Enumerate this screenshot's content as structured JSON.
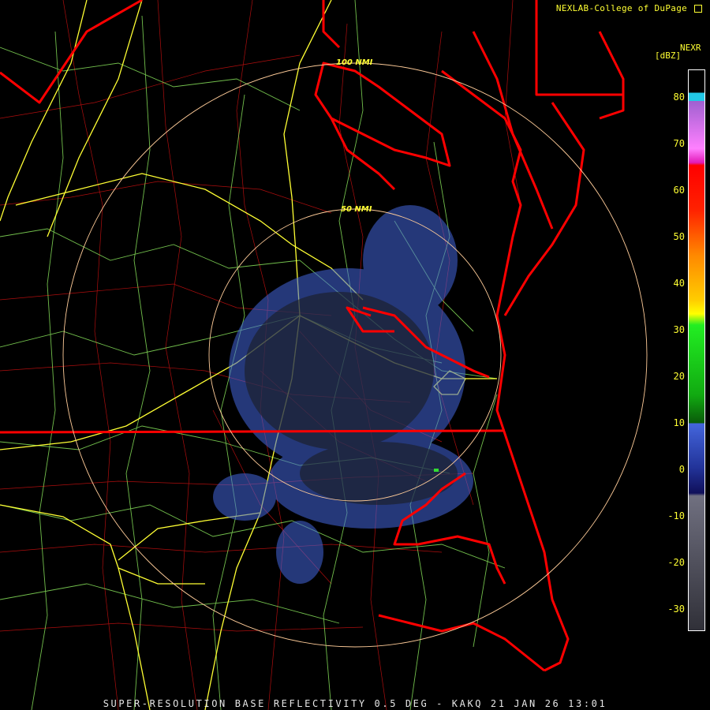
{
  "credit": "NEXLAB-College of DuPage",
  "footer": "SUPER-RESOLUTION BASE REFLECTIVITY 0.5 DEG - KAKQ 21 JAN 26 13:01",
  "rings": [
    {
      "label": "100 NMI"
    },
    {
      "label": "50 NMI"
    }
  ],
  "legend": {
    "title": "NEXR",
    "unit": "[dBZ]",
    "ticks": [
      "80",
      "70",
      "60",
      "50",
      "40",
      "30",
      "20",
      "10",
      "0",
      "-10",
      "-20",
      "-30"
    ]
  },
  "colors": {
    "state_border": "#ff0000",
    "county_border": "#cc0000",
    "highway": "#ffff33",
    "road": "#99ff66",
    "ring": "#ffcc99",
    "light_echo": "#4466dd"
  }
}
